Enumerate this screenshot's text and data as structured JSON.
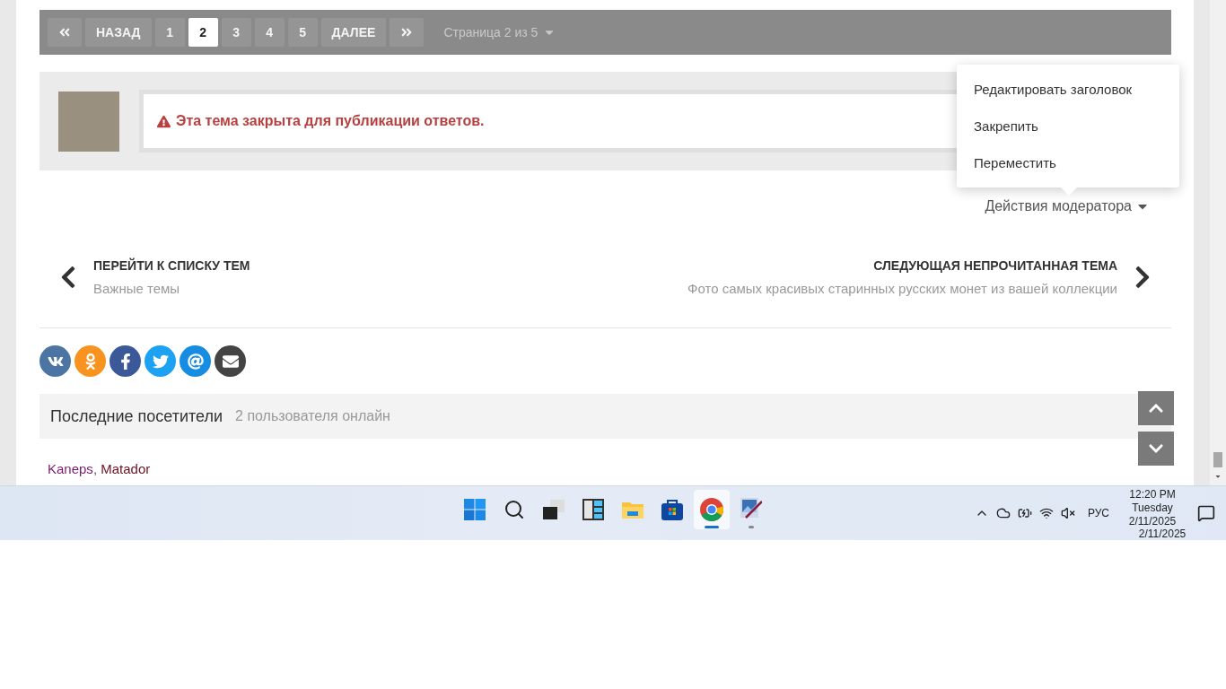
{
  "pagination": {
    "previous": "НАЗАД",
    "next": "ДАЛЕЕ",
    "pages": [
      {
        "label": "1",
        "selected": false
      },
      {
        "label": "2",
        "selected": true
      },
      {
        "label": "3",
        "selected": false
      },
      {
        "label": "4",
        "selected": false
      },
      {
        "label": "5",
        "selected": false
      }
    ],
    "page_info": "Страница 2 из 5"
  },
  "notice": {
    "text": "Эта тема закрыта для публикации ответов."
  },
  "moderator_menu": {
    "items": [
      "Редактировать заголовок",
      "Закрепить",
      "Переместить"
    ],
    "toggle": "Действия модератора"
  },
  "topic_nav": {
    "previous": {
      "heading": "ПЕРЕЙТИ К СПИСКУ ТЕМ",
      "title": "Важные темы"
    },
    "next": {
      "heading": "СЛЕДУЮЩАЯ НЕПРОЧИТАННАЯ ТЕМА",
      "title": "Фото самых красивых старинных русских монет из вашей коллекции"
    }
  },
  "share": [
    {
      "kind": "vk",
      "color": "#4c75a3"
    },
    {
      "kind": "ok",
      "color": "#f7931e"
    },
    {
      "kind": "facebook",
      "color": "#3b5998"
    },
    {
      "kind": "twitter",
      "color": "#1da1f2"
    },
    {
      "kind": "mail",
      "color": "#168de2"
    },
    {
      "kind": "email",
      "color": "#444444"
    }
  ],
  "visitors": {
    "title": "Последние посетители",
    "count": "2 пользователя онлайн",
    "separator": ", ",
    "users": [
      {
        "name": "Kaneps",
        "color": "#7a1a6e"
      },
      {
        "name": "Matador",
        "color": "#6b1020"
      }
    ]
  },
  "taskbar": {
    "apps": [
      {
        "kind": "start",
        "selected": false,
        "running": false
      },
      {
        "kind": "search",
        "selected": false,
        "running": false
      },
      {
        "kind": "taskview",
        "selected": false,
        "running": false
      },
      {
        "kind": "widgets",
        "selected": false,
        "running": false
      },
      {
        "kind": "explorer",
        "selected": false,
        "running": false
      },
      {
        "kind": "store",
        "selected": false,
        "running": false
      },
      {
        "kind": "chrome",
        "selected": true,
        "running": true
      },
      {
        "kind": "paint",
        "selected": false,
        "running": true
      }
    ],
    "language": "РУС",
    "time": "12:20 PM",
    "day": "Tuesday",
    "date": "2/11/2025",
    "date_repeat": "2/11/2025"
  }
}
